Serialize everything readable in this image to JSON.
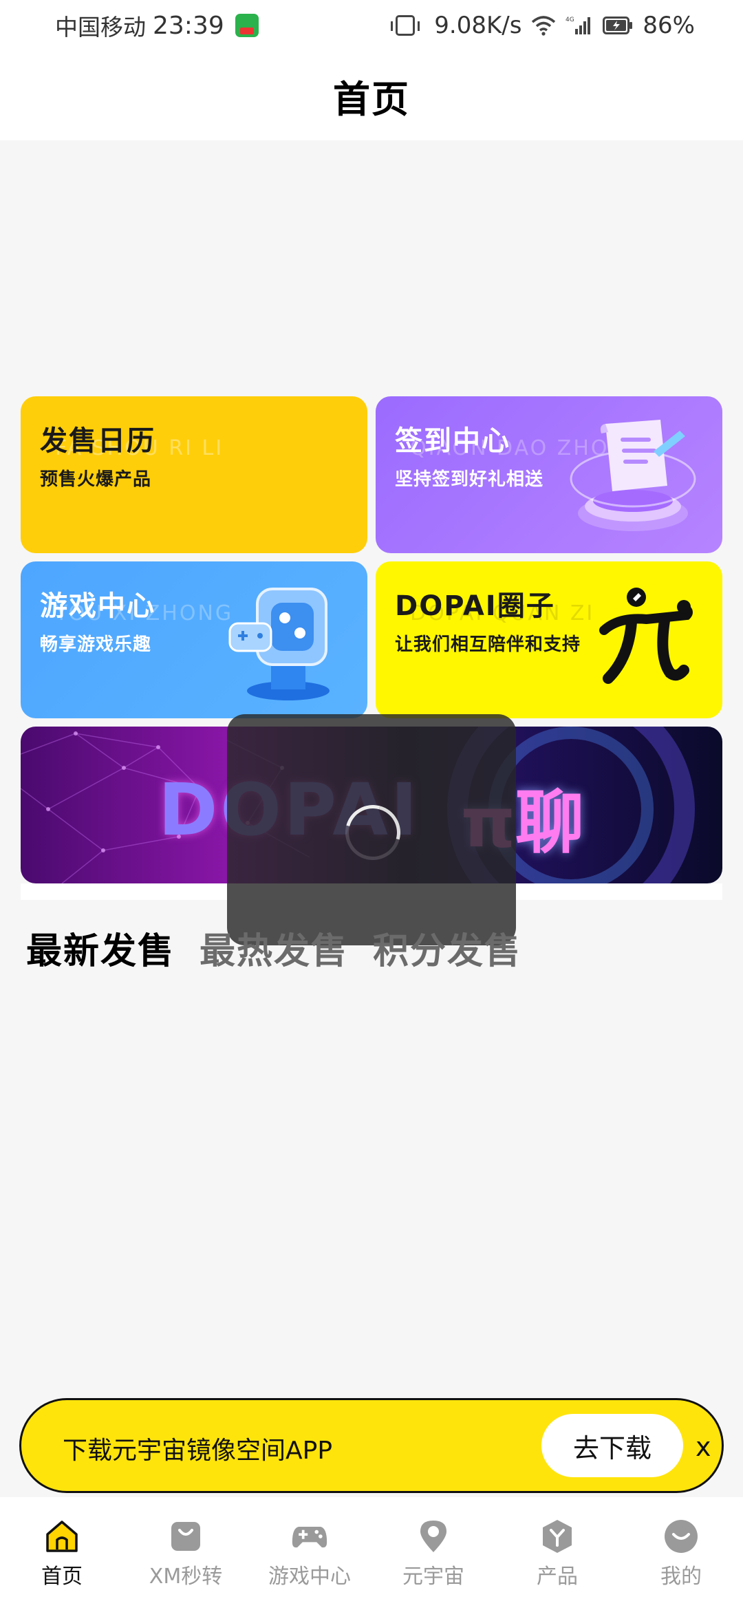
{
  "status_bar": {
    "carrier": "中国移动",
    "time": "23:39",
    "net_speed": "9.08K/s",
    "network_type": "4G",
    "battery": "86%"
  },
  "header": {
    "title": "首页"
  },
  "cards": {
    "calendar": {
      "title": "发售日历",
      "subtitle": "预售火爆产品",
      "watermark": "FA SHOU RI LI"
    },
    "checkin": {
      "title": "签到中心",
      "subtitle": "坚持签到好礼相送",
      "watermark": "QIAON DAO ZHO"
    },
    "games": {
      "title": "游戏中心",
      "subtitle": "畅享游戏乐趣",
      "watermark": "YOU XI ZHONG"
    },
    "circle": {
      "title": "DOPAI圈子",
      "subtitle": "让我们相互陪伴和支持",
      "watermark": "DOPAI QUAN ZI"
    },
    "banner": {
      "left_text": "DOPAI",
      "right_text": "π聊"
    }
  },
  "sales_tabs": [
    "最新发售",
    "最热发售",
    "积分发售"
  ],
  "download_bar": {
    "text": "下载元宇宙镜像空间APP",
    "button": "去下载",
    "close": "x"
  },
  "bottom_nav": [
    {
      "label": "首页",
      "icon": "home-icon",
      "active": true
    },
    {
      "label": "XM秒转",
      "icon": "bag-icon",
      "active": false
    },
    {
      "label": "游戏中心",
      "icon": "gamepad-icon",
      "active": false
    },
    {
      "label": "元宇宙",
      "icon": "location-pin-icon",
      "active": false
    },
    {
      "label": "产品",
      "icon": "cube-icon",
      "active": false
    },
    {
      "label": "我的",
      "icon": "smile-icon",
      "active": false
    }
  ],
  "colors": {
    "accent_yellow": "#ffe40c",
    "calendar_card": "#ffce0a",
    "checkin_card": "#9b6bff",
    "games_card": "#4ea6ff",
    "circle_card": "#fff700"
  }
}
